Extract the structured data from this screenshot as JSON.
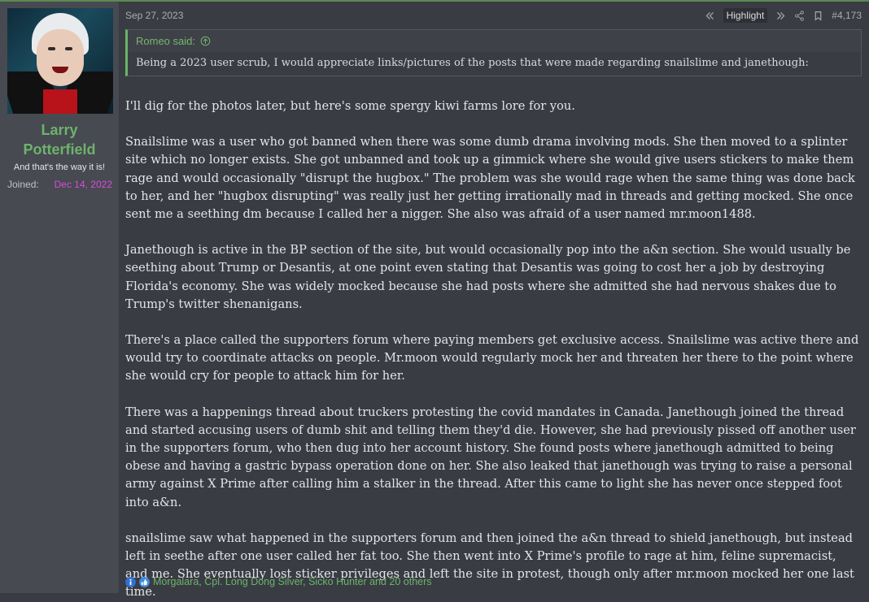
{
  "post": {
    "date": "Sep 27, 2023",
    "highlight_label": "Highlight",
    "post_number": "#4,173"
  },
  "user": {
    "name": "Larry Potterfield",
    "title": "And that's the way it is!",
    "joined_label": "Joined:",
    "joined_date": "Dec 14, 2022"
  },
  "quote": {
    "author": "Romeo said:",
    "text": "Being a 2023 user scrub, I would appreciate links/pictures of the posts that were made regarding snailslime and janethough:"
  },
  "paragraphs": [
    "I'll dig for the photos later, but here's some spergy kiwi farms lore for you.",
    "Snailslime was a user who got banned when there was some dumb drama involving mods. She then moved to a splinter site which no longer exists. She got unbanned and took up a gimmick where she would give users stickers to make them rage and would occasionally \"disrupt the hugbox.\" The problem was she would rage when the same thing was done back to her, and her \"hugbox disrupting\" was really just her getting irrationally mad in threads and getting mocked. She once sent me a seething dm because I called her a nigger. She also was afraid of a user named mr.moon1488.",
    "Janethough is active in the BP section of the site, but would occasionally pop into the a&n section. She would usually be seething about Trump or Desantis, at one point even stating that Desantis was going to cost her a job by destroying Florida's economy. She was widely mocked because she had posts where she admitted she had nervous shakes due to Trump's twitter shenanigans.",
    "There's a place called the supporters forum where paying members get exclusive access. Snailslime was active there and would try to coordinate attacks on people. Mr.moon would regularly mock her and threaten her there to the point where she would cry for people to attack him for her.",
    "There was a happenings thread about truckers protesting the covid mandates in Canada. Janethough joined the thread and started accusing users of dumb shit and telling them they'd die. However, she had previously pissed off another user in the supporters forum, who then dug into her account history. She found posts where janethough admitted to being obese and having a gastric bypass operation done on her. She also leaked that janethough was trying to raise a personal army against X Prime after calling him a stalker in the thread. After this came to light she has never once stepped foot into a&n.",
    "snailslime saw what happened in the supporters forum and then joined the a&n thread to shield janethough, but instead left in seethe after one user called her fat too. She then went into X Prime's profile to rage at him, feline supremacist, and me. She eventually lost sticker privileges and left the site in protest, though only after mr.moon mocked her one last time."
  ],
  "reactions": {
    "text": "Morgalara, Cpl. Long Dong Silver, Sicko Hunter and 20 others",
    "icons": [
      "informative-icon",
      "like-icon"
    ]
  },
  "colors": {
    "accent_green": "#6db36b",
    "joined_magenta": "#d94adb",
    "background": "#393c43",
    "sidebar": "#474a51"
  }
}
